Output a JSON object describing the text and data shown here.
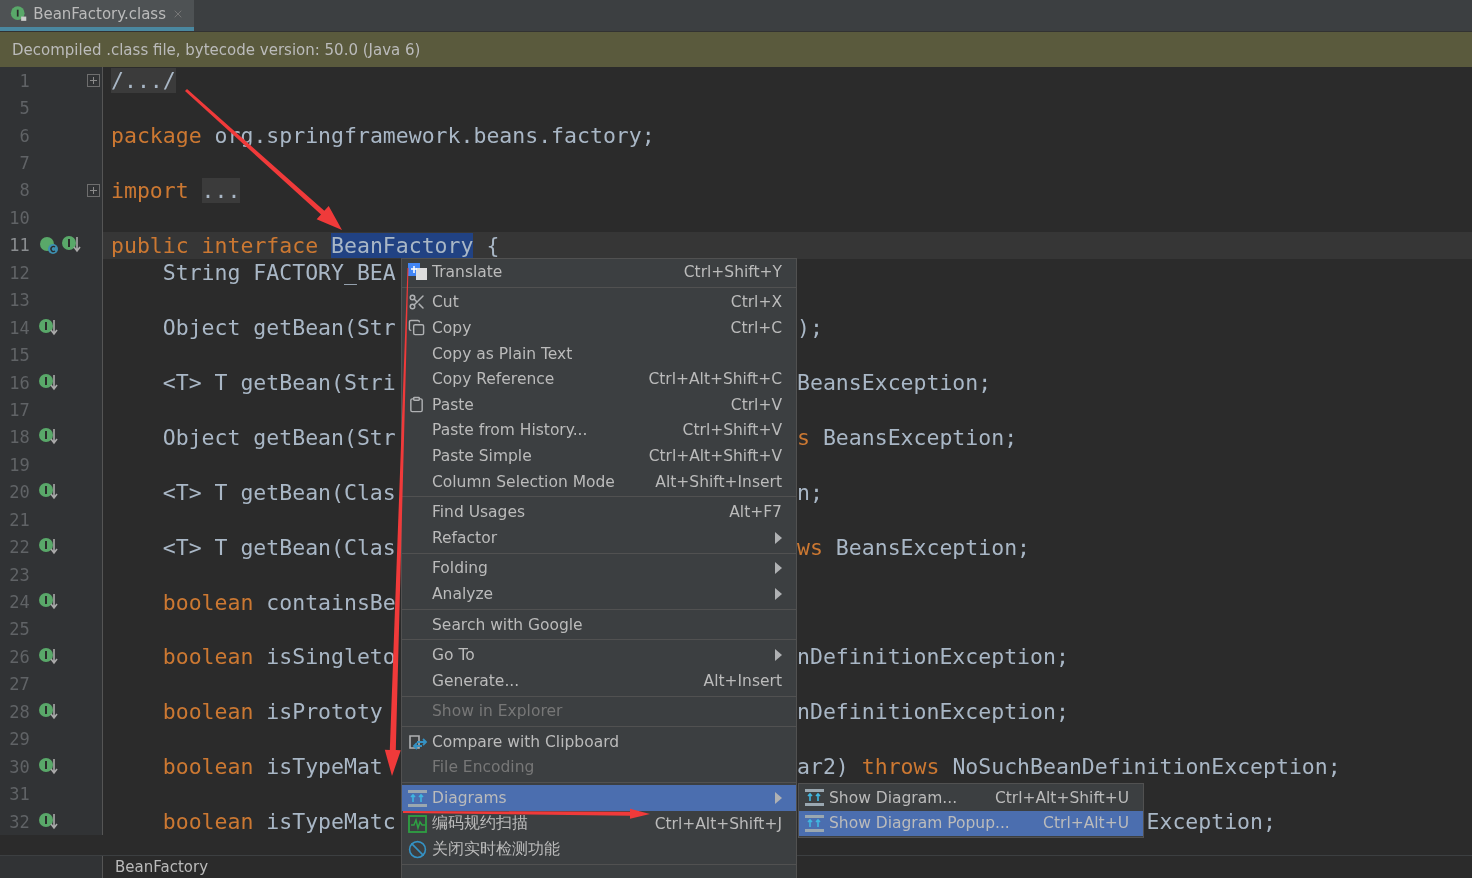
{
  "tab": {
    "title": "BeanFactory.class",
    "selected": true
  },
  "banner": "Decompiled .class file, bytecode version: 50.0 (Java 6)",
  "lines": [
    {
      "number": "1",
      "folded": true,
      "current": false,
      "kind": "plain",
      "code": [
        {
          "text": "/.../",
          "kind": "folded"
        }
      ]
    },
    {
      "number": "5",
      "current": false,
      "kind": "plain"
    },
    {
      "number": "6",
      "current": false,
      "kind": "plain",
      "code": [
        {
          "text": "package",
          "kind": "keyword"
        },
        {
          "text": " org.springframework.beans.factory;",
          "kind": "plain"
        }
      ]
    },
    {
      "number": "7",
      "current": false,
      "kind": "plain"
    },
    {
      "number": "8",
      "folded": true,
      "current": false,
      "kind": "plain",
      "code": [
        {
          "text": "import",
          "kind": "keyword"
        },
        {
          "text": "...",
          "kind": "folded"
        }
      ]
    },
    {
      "number": "10",
      "current": false,
      "kind": "plain"
    },
    {
      "number": "11",
      "kind": "hierarchy",
      "current": true,
      "code": [
        {
          "text": "public interface ",
          "kind": "keyword"
        },
        {
          "text": "BeanFactory",
          "kind": "selected"
        },
        {
          "text": " {",
          "kind": "plain"
        }
      ]
    },
    {
      "number": "12",
      "indented": true,
      "current": false,
      "kind": "plain",
      "code": [
        {
          "text": "String FACTORY_BEA",
          "kind": "plain"
        }
      ]
    },
    {
      "number": "13",
      "current": false,
      "kind": "plain"
    },
    {
      "number": "14",
      "kind": "implemented",
      "indented": true,
      "current": false,
      "code": [
        {
          "text": "Object getBean(Str",
          "kind": "plain"
        }
      ],
      "after_menu": [
        {
          "text": ");",
          "kind": "plain"
        }
      ]
    },
    {
      "number": "15",
      "current": false,
      "kind": "plain"
    },
    {
      "number": "16",
      "kind": "implemented",
      "indented": true,
      "current": false,
      "code": [
        {
          "text": "<T> T getBean(Stri",
          "kind": "plain"
        }
      ],
      "after_menu": [
        {
          "text": "BeansException;",
          "kind": "plain"
        }
      ]
    },
    {
      "number": "17",
      "current": false,
      "kind": "plain"
    },
    {
      "number": "18",
      "kind": "implemented",
      "indented": true,
      "current": false,
      "code": [
        {
          "text": "Object getBean(Str",
          "kind": "plain"
        }
      ],
      "after_menu": [
        {
          "text": "s",
          "kind": "keyword"
        },
        {
          "text": " BeansException;",
          "kind": "plain"
        }
      ]
    },
    {
      "number": "19",
      "current": false,
      "kind": "plain"
    },
    {
      "number": "20",
      "kind": "implemented",
      "indented": true,
      "current": false,
      "code": [
        {
          "text": "<T> T getBean(Clas",
          "kind": "plain"
        }
      ],
      "after_menu": [
        {
          "text": "n;",
          "kind": "plain"
        }
      ]
    },
    {
      "number": "21",
      "current": false,
      "kind": "plain"
    },
    {
      "number": "22",
      "kind": "implemented",
      "indented": true,
      "current": false,
      "code": [
        {
          "text": "<T> T getBean(Clas",
          "kind": "plain"
        }
      ],
      "after_menu": [
        {
          "text": "ws",
          "kind": "keyword"
        },
        {
          "text": " BeansException;",
          "kind": "plain"
        }
      ]
    },
    {
      "number": "23",
      "current": false,
      "kind": "plain"
    },
    {
      "number": "24",
      "kind": "implemented",
      "indented": true,
      "current": false,
      "code": [
        {
          "text": "boolean",
          "kind": "keyword"
        },
        {
          "text": " containsBe",
          "kind": "plain"
        }
      ]
    },
    {
      "number": "25",
      "current": false,
      "kind": "plain"
    },
    {
      "number": "26",
      "kind": "implemented",
      "indented": true,
      "current": false,
      "code": [
        {
          "text": "boolean",
          "kind": "keyword"
        },
        {
          "text": " isSingleto",
          "kind": "plain"
        }
      ],
      "after_menu": [
        {
          "text": "nDefinitionException;",
          "kind": "plain"
        }
      ]
    },
    {
      "number": "27",
      "current": false,
      "kind": "plain"
    },
    {
      "number": "28",
      "kind": "implemented",
      "indented": true,
      "current": false,
      "code": [
        {
          "text": "boolean",
          "kind": "keyword"
        },
        {
          "text": " isPrototy",
          "kind": "plain"
        }
      ],
      "after_menu": [
        {
          "text": "nDefinitionException;",
          "kind": "plain"
        }
      ]
    },
    {
      "number": "29",
      "current": false,
      "kind": "plain"
    },
    {
      "number": "30",
      "kind": "implemented",
      "indented": true,
      "current": false,
      "code": [
        {
          "text": "boolean",
          "kind": "keyword"
        },
        {
          "text": " isTypeMat",
          "kind": "plain"
        }
      ],
      "after_menu": [
        {
          "text": "ar2) ",
          "kind": "plain"
        },
        {
          "text": "throws",
          "kind": "keyword"
        },
        {
          "text": " NoSuchBeanDefinitionException;",
          "kind": "plain"
        }
      ]
    },
    {
      "number": "31",
      "current": false,
      "kind": "plain"
    },
    {
      "number": "32",
      "kind": "implemented",
      "indented": true,
      "current": false,
      "code": [
        {
          "text": "boolean",
          "kind": "keyword"
        },
        {
          "text": " isTypeMatc",
          "kind": "plain"
        }
      ],
      "after_submenu": [
        {
          "text": "Exception;",
          "kind": "plain"
        }
      ]
    }
  ],
  "breadcrumb": "BeanFactory",
  "menu": {
    "groups": [
      [
        {
          "label": "Translate",
          "shortcut": "Ctrl+Shift+Y",
          "kind": "translate",
          "selected": false,
          "disabled": false,
          "submenu": false
        }
      ],
      [
        {
          "label": "Cut",
          "shortcut": "Ctrl+X",
          "kind": "cut",
          "selected": false,
          "disabled": false,
          "submenu": false
        },
        {
          "label": "Copy",
          "shortcut": "Ctrl+C",
          "kind": "copy",
          "selected": false,
          "disabled": false,
          "submenu": false
        },
        {
          "label": "Copy as Plain Text",
          "kind": "plain",
          "selected": false,
          "disabled": false,
          "submenu": false
        },
        {
          "label": "Copy Reference",
          "shortcut": "Ctrl+Alt+Shift+C",
          "kind": "plain",
          "selected": false,
          "disabled": false,
          "submenu": false
        },
        {
          "label": "Paste",
          "shortcut": "Ctrl+V",
          "kind": "paste",
          "selected": false,
          "disabled": false,
          "submenu": false
        },
        {
          "label": "Paste from History...",
          "shortcut": "Ctrl+Shift+V",
          "kind": "plain",
          "selected": false,
          "disabled": false,
          "submenu": false
        },
        {
          "label": "Paste Simple",
          "shortcut": "Ctrl+Alt+Shift+V",
          "kind": "plain",
          "selected": false,
          "disabled": false,
          "submenu": false
        },
        {
          "label": "Column Selection Mode",
          "shortcut": "Alt+Shift+Insert",
          "kind": "plain",
          "selected": false,
          "disabled": false,
          "submenu": false
        }
      ],
      [
        {
          "label": "Find Usages",
          "shortcut": "Alt+F7",
          "kind": "plain",
          "selected": false,
          "disabled": false,
          "submenu": false
        },
        {
          "label": "Refactor",
          "kind": "plain",
          "selected": false,
          "disabled": false,
          "submenu": true
        }
      ],
      [
        {
          "label": "Folding",
          "kind": "plain",
          "selected": false,
          "disabled": false,
          "submenu": true
        },
        {
          "label": "Analyze",
          "kind": "plain",
          "selected": false,
          "disabled": false,
          "submenu": true
        }
      ],
      [
        {
          "label": "Search with Google",
          "kind": "plain",
          "selected": false,
          "disabled": false,
          "submenu": false
        }
      ],
      [
        {
          "label": "Go To",
          "kind": "plain",
          "selected": false,
          "disabled": false,
          "submenu": true
        },
        {
          "label": "Generate...",
          "shortcut": "Alt+Insert",
          "kind": "plain",
          "selected": false,
          "disabled": false,
          "submenu": false
        }
      ],
      [
        {
          "label": "Show in Explorer",
          "kind": "plain",
          "selected": false,
          "disabled": true,
          "submenu": false
        }
      ],
      [
        {
          "label": "Compare with Clipboard",
          "kind": "compare",
          "selected": false,
          "disabled": false,
          "submenu": false
        },
        {
          "label": "File Encoding",
          "kind": "plain",
          "selected": false,
          "disabled": true,
          "submenu": false
        }
      ],
      [
        {
          "label": "Diagrams",
          "kind": "diagram",
          "selected": true,
          "disabled": false,
          "submenu": true
        },
        {
          "label": "编码规约扫描",
          "shortcut": "Ctrl+Alt+Shift+J",
          "kind": "scan",
          "selected": false,
          "disabled": false,
          "submenu": false
        },
        {
          "label": "关闭实时检测功能",
          "kind": "forbid",
          "selected": false,
          "disabled": false,
          "submenu": false
        }
      ]
    ]
  },
  "submenu": {
    "items": [
      {
        "label": "Show Diagram...",
        "shortcut": "Ctrl+Alt+Shift+U",
        "selected": false
      },
      {
        "label": "Show Diagram Popup...",
        "shortcut": "Ctrl+Alt+U",
        "selected": true
      }
    ]
  }
}
